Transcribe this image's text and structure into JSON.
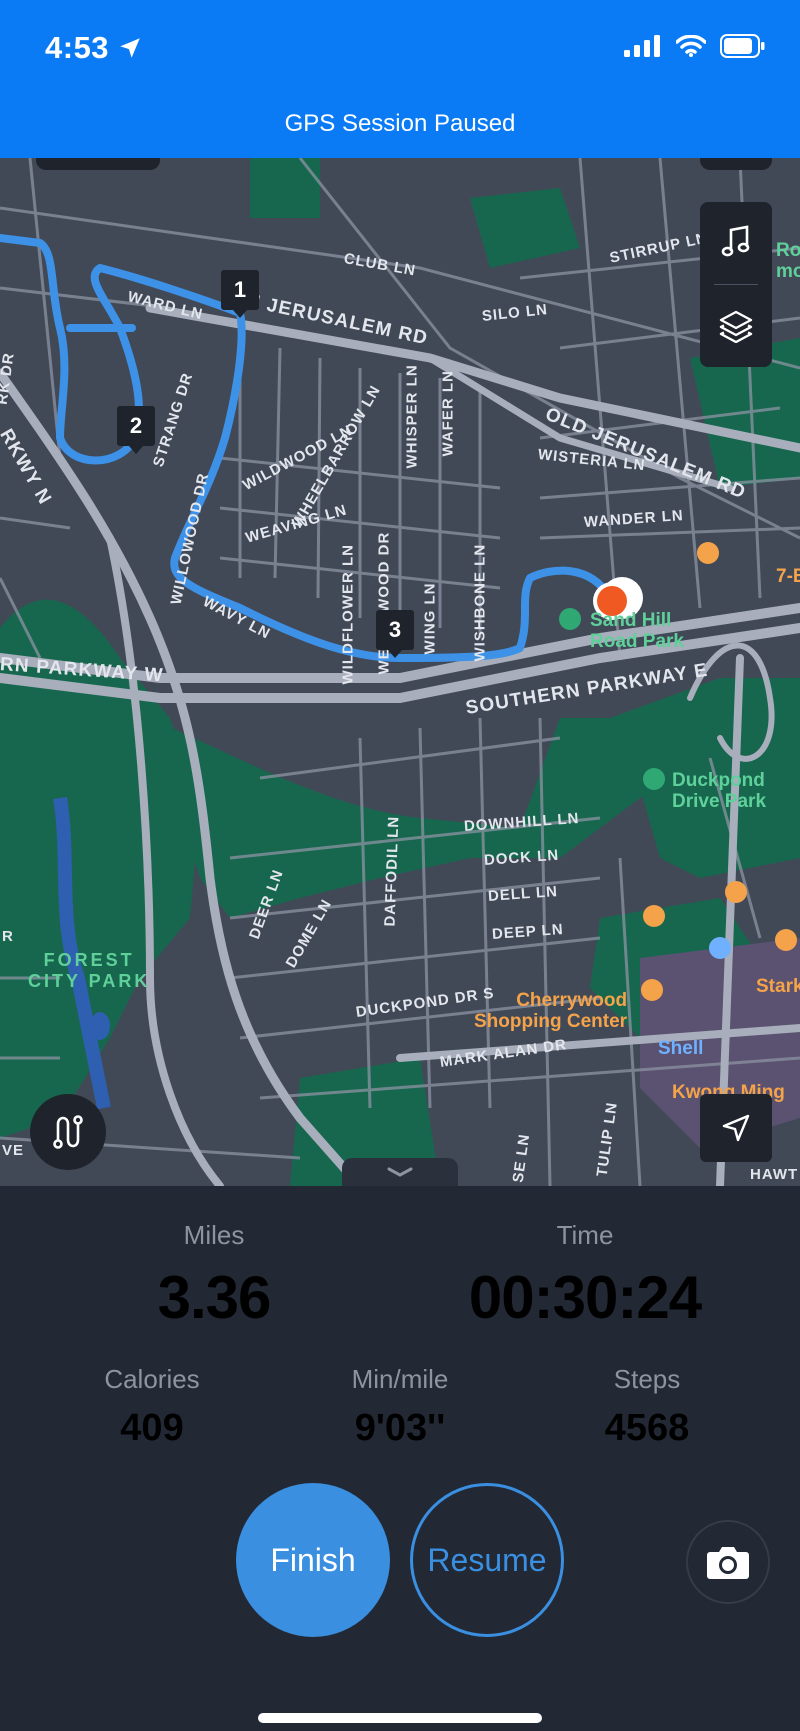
{
  "status_bar": {
    "time": "4:53"
  },
  "banner": {
    "text": "GPS Session Paused"
  },
  "map": {
    "streets": {
      "club_ln": "CLUB LN",
      "stirrup_ln": "STIRRUP LN",
      "ward_ln": "WARD LN",
      "n_jerusalem_rd": "N JERUSALEM RD",
      "silo_ln": "SILO LN",
      "old_jerusalem_rd": "OLD JERUSALEM RD",
      "strang_dr": "STRANG DR",
      "wildwood_ln": "WILDWOOD LN",
      "wheelbarrow_ln": "WHEELBARROW LN",
      "whisper_ln": "WHISPER LN",
      "wafer_ln": "WAFER LN",
      "wisteria_ln": "WISTERIA LN",
      "willowood_dr": "WILLOWOOD DR",
      "weaving_ln": "WEAVING LN",
      "wander_ln": "WANDER LN",
      "wavy_ln": "WAVY LN",
      "wildflower_ln": "WILDFLOWER LN",
      "wedgewood_dr": "WEDGEWOOD DR",
      "wing_ln": "WING LN",
      "wishbone_ln": "WISHBONE LN",
      "parkway_w": "RN PARKWAY W",
      "southern_parkway_e": "SOUTHERN PARKWAY E",
      "pkwy_n": "RKWY N",
      "rk_dr": "RK DR",
      "downhill_ln": "DOWNHILL LN",
      "dock_ln": "DOCK LN",
      "dell_ln": "DELL LN",
      "deep_ln": "DEEP LN",
      "daffodil_ln": "DAFFODIL LN",
      "deer_ln": "DEER LN",
      "dome_ln": "DOME LN",
      "duckpond_dr_s": "DUCKPOND DR S",
      "mark_alan_dr": "MARK ALAN DR",
      "tulip_ln": "TULIP LN",
      "se_ln": "SE LN",
      "hawt": "HAWT",
      "ve": "VE",
      "r": "R"
    },
    "pois": {
      "park1": "Sand Hill\nRoad Park",
      "park2": "Duckpond\nDrive Park",
      "forest_city_park": "FOREST\nCITY PARK",
      "cherrywood": "Cherrywood\nShopping Center",
      "shell": "Shell",
      "kwong_ming": "Kwong Ming",
      "stark": "Stark",
      "seven_eleven": "7-E",
      "ro_mo": "Ro\nmo"
    },
    "markers": [
      "1",
      "2",
      "3"
    ],
    "icons": {
      "music": "music-note-icon",
      "layers": "layers-icon",
      "route": "route-icon",
      "locate": "location-arrow-icon",
      "handle": "chevron-down-icon"
    }
  },
  "stats": {
    "miles": {
      "label": "Miles",
      "value": "3.36"
    },
    "time": {
      "label": "Time",
      "value": "00:30:24"
    },
    "calories": {
      "label": "Calories",
      "value": "409"
    },
    "pace": {
      "label": "Min/mile",
      "value": "9'03''"
    },
    "steps": {
      "label": "Steps",
      "value": "4568"
    }
  },
  "buttons": {
    "finish": "Finish",
    "resume": "Resume"
  },
  "colors": {
    "banner": "#0A7BF5",
    "route": "#3d92e8",
    "accent": "#3a8fe0",
    "current_location": "#f05a22",
    "park": "#17674f",
    "panel": "#222935"
  }
}
